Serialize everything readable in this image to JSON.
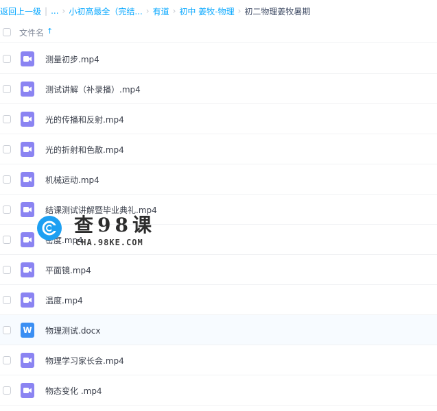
{
  "breadcrumb": {
    "back": "返回上一级",
    "ellipsis": "...",
    "items": [
      "小初高最全（完结...",
      "有道",
      "初中 姜牧-物理"
    ],
    "current": "初二物理姜牧暑期"
  },
  "header": {
    "name_column": "文件名",
    "sort_icon": "sort-ascending-icon"
  },
  "files": [
    {
      "name": "测量初步.mp4",
      "type": "video"
    },
    {
      "name": "测试讲解（补录播）.mp4",
      "type": "video"
    },
    {
      "name": "光的传播和反射.mp4",
      "type": "video"
    },
    {
      "name": "光的折射和色散.mp4",
      "type": "video"
    },
    {
      "name": "机械运动.mp4",
      "type": "video"
    },
    {
      "name": "结课测试讲解暨毕业典礼.mp4",
      "type": "video"
    },
    {
      "name": "密度.mp4",
      "type": "video"
    },
    {
      "name": "平面镜.mp4",
      "type": "video"
    },
    {
      "name": "温度.mp4",
      "type": "video"
    },
    {
      "name": "物理测试.docx",
      "type": "word",
      "icon_letter": "W"
    },
    {
      "name": "物理学习家长会.mp4",
      "type": "video"
    },
    {
      "name": "物态变化 .mp4",
      "type": "video"
    }
  ],
  "watermark": {
    "title": "查98课",
    "subtitle": "CHA.98KE.COM"
  },
  "colors": {
    "link": "#06a7ff",
    "video_icon": "#8b84f2",
    "word_icon": "#3b8ff3"
  }
}
